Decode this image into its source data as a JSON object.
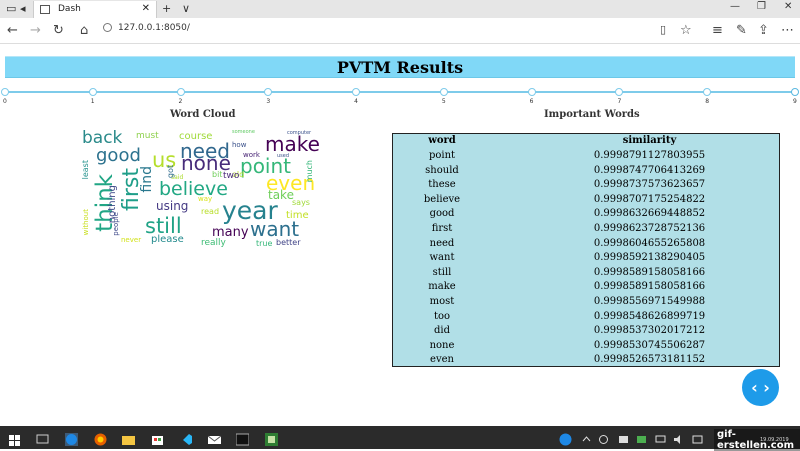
{
  "browser": {
    "tab_title": "Dash",
    "url": "127.0.0.1:8050/",
    "new_tab": "+",
    "tab_menu": "∨"
  },
  "page": {
    "title": "PVTM Results",
    "slider_ticks": [
      "0",
      "1",
      "2",
      "3",
      "4",
      "5",
      "6",
      "7",
      "8",
      "9"
    ],
    "slider_value": 9,
    "word_cloud_title": "Word Cloud",
    "important_words_title": "Important Words"
  },
  "word_cloud": {
    "words": [
      {
        "text": "back",
        "color": "#2a8a8a"
      },
      {
        "text": "must",
        "color": "#8fd14f"
      },
      {
        "text": "course",
        "color": "#a0da39"
      },
      {
        "text": "someone",
        "color": "#5ec962"
      },
      {
        "text": "computer",
        "color": "#3b528b"
      },
      {
        "text": "good",
        "color": "#2c728e"
      },
      {
        "text": "us",
        "color": "#b5de2b"
      },
      {
        "text": "need",
        "color": "#31688e"
      },
      {
        "text": "make",
        "color": "#440154"
      },
      {
        "text": "how",
        "color": "#3b528b"
      },
      {
        "text": "none",
        "color": "#472c7a"
      },
      {
        "text": "work",
        "color": "#482475"
      },
      {
        "text": "point",
        "color": "#35b779"
      },
      {
        "text": "used",
        "color": "#3b528b"
      },
      {
        "text": "least",
        "color": "#21918c"
      },
      {
        "text": "first",
        "color": "#1f9e89"
      },
      {
        "text": "find",
        "color": "#2a788e"
      },
      {
        "text": "bit",
        "color": "#6ece58"
      },
      {
        "text": "old",
        "color": "#b5de2b"
      },
      {
        "text": "two",
        "color": "#482878"
      },
      {
        "text": "even",
        "color": "#fde725"
      },
      {
        "text": "much",
        "color": "#35b779"
      },
      {
        "text": "think",
        "color": "#21a685"
      },
      {
        "text": "nothing",
        "color": "#3e4a89"
      },
      {
        "text": "believe",
        "color": "#22a884"
      },
      {
        "text": "said",
        "color": "#addc30"
      },
      {
        "text": "way",
        "color": "#d8e219"
      },
      {
        "text": "take",
        "color": "#6ece58"
      },
      {
        "text": "using",
        "color": "#443983"
      },
      {
        "text": "year",
        "color": "#26828e"
      },
      {
        "text": "says",
        "color": "#a0da39"
      },
      {
        "text": "without",
        "color": "#c8e020"
      },
      {
        "text": "read",
        "color": "#b8de29"
      },
      {
        "text": "time",
        "color": "#c2df23"
      },
      {
        "text": "people",
        "color": "#3e4989"
      },
      {
        "text": "still",
        "color": "#20a386"
      },
      {
        "text": "many",
        "color": "#440154"
      },
      {
        "text": "want",
        "color": "#2d708e"
      },
      {
        "text": "never",
        "color": "#d2e21b"
      },
      {
        "text": "please",
        "color": "#238a8d"
      },
      {
        "text": "really",
        "color": "#3dbc74"
      },
      {
        "text": "true",
        "color": "#35b779"
      },
      {
        "text": "better",
        "color": "#414487"
      },
      {
        "text": "got",
        "color": "#2f6c8e"
      }
    ]
  },
  "important_words": {
    "columns": [
      "word",
      "similarity"
    ],
    "rows": [
      [
        "point",
        "0.9998791127803955"
      ],
      [
        "should",
        "0.9998747706413269"
      ],
      [
        "these",
        "0.9998737573623657"
      ],
      [
        "believe",
        "0.9998707175254822"
      ],
      [
        "good",
        "0.9998632669448852"
      ],
      [
        "first",
        "0.9998623728752136"
      ],
      [
        "need",
        "0.9998604655265808"
      ],
      [
        "want",
        "0.9998592138290405"
      ],
      [
        "still",
        "0.9998589158058166"
      ],
      [
        "make",
        "0.9998589158058166"
      ],
      [
        "most",
        "0.9998556971549988"
      ],
      [
        "too",
        "0.9998548626899719"
      ],
      [
        "did",
        "0.9998537302017212"
      ],
      [
        "none",
        "0.9998530745506287"
      ],
      [
        "even",
        "0.9998526573181152"
      ]
    ]
  },
  "watermark": "gif-erstellen.com",
  "clock_date": "19.09.2019",
  "colors": {
    "header_bg": "#80d8f7",
    "table_bg": "#b1dfe7",
    "fab": "#1e9be9"
  }
}
